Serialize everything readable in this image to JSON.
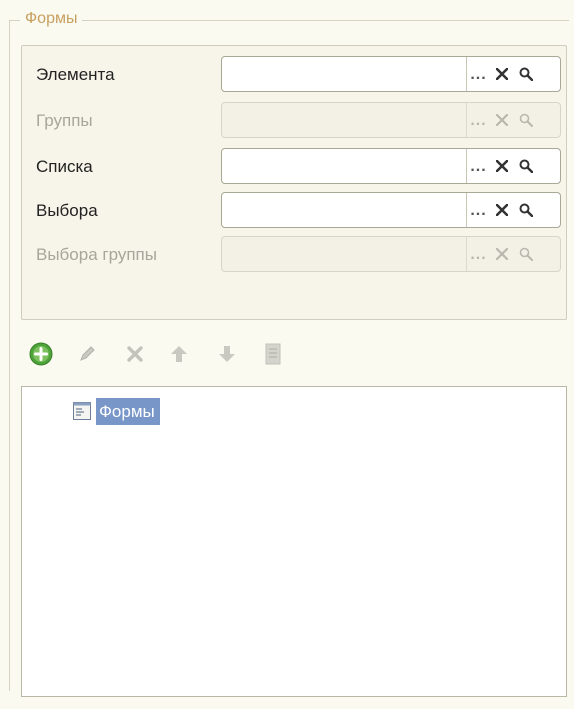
{
  "group": {
    "title": "Формы"
  },
  "fields": [
    {
      "label": "Элемента",
      "enabled": true,
      "value": ""
    },
    {
      "label": "Группы",
      "enabled": false,
      "value": ""
    },
    {
      "label": "Списка",
      "enabled": true,
      "value": ""
    },
    {
      "label": "Выбора",
      "enabled": true,
      "value": ""
    },
    {
      "label": "Выбора группы",
      "enabled": false,
      "value": ""
    }
  ],
  "field_buttons": {
    "select": "...",
    "clear_icon": "clear-icon",
    "open_icon": "magnifier-icon"
  },
  "toolbar": {
    "items": [
      "add-icon",
      "edit-icon",
      "delete-icon",
      "move-up-icon",
      "move-down-icon",
      "document-icon"
    ]
  },
  "tree": {
    "items": [
      {
        "label": "Формы",
        "selected": true,
        "icon": "form-icon"
      }
    ]
  },
  "colors": {
    "background": "#fbfaf1",
    "title": "#c8a060",
    "selection": "#7896c8",
    "add_green": "#4ea23a"
  }
}
